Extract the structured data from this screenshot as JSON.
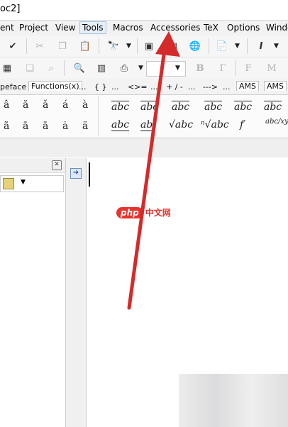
{
  "window": {
    "title_fragment": "oc2]"
  },
  "menubar": {
    "items": [
      "ent",
      "Project",
      "View",
      "Tools",
      "Macros",
      "Accessories",
      "TeX",
      "Options",
      "Windo"
    ]
  },
  "symbol_tabs": [
    "peface",
    "Functions(x)",
    "...",
    "{ }",
    "...",
    "<>=",
    "...",
    "+ / -",
    "...",
    "--->",
    "...",
    "AMS",
    "AMS"
  ],
  "symbols": {
    "accents_row1": [
      "â",
      "ă",
      "ǎ",
      "á",
      "à"
    ],
    "accents_row2": [
      "ã",
      "ā",
      "ā",
      "ȧ",
      "ä"
    ],
    "decor_row1": [
      "abc",
      "abc",
      "abc",
      "abc",
      "abc",
      "abc"
    ],
    "decor_row2": [
      "abc",
      "ab",
      "√abc",
      "ⁿ√abc",
      "f′",
      "abc/xyz"
    ]
  },
  "watermark": {
    "logo": "php",
    "text": "中文网"
  },
  "annotation": {
    "arrow_color": "#d42a2a"
  },
  "icons": [
    "spellcheck-icon",
    "cut-icon",
    "copy-icon",
    "paste-icon",
    "find-icon",
    "image-icon",
    "window-icon",
    "globe-icon",
    "document-icon",
    "italic-icon",
    "bold-icon",
    "close-icon",
    "arrow-right-icon"
  ]
}
